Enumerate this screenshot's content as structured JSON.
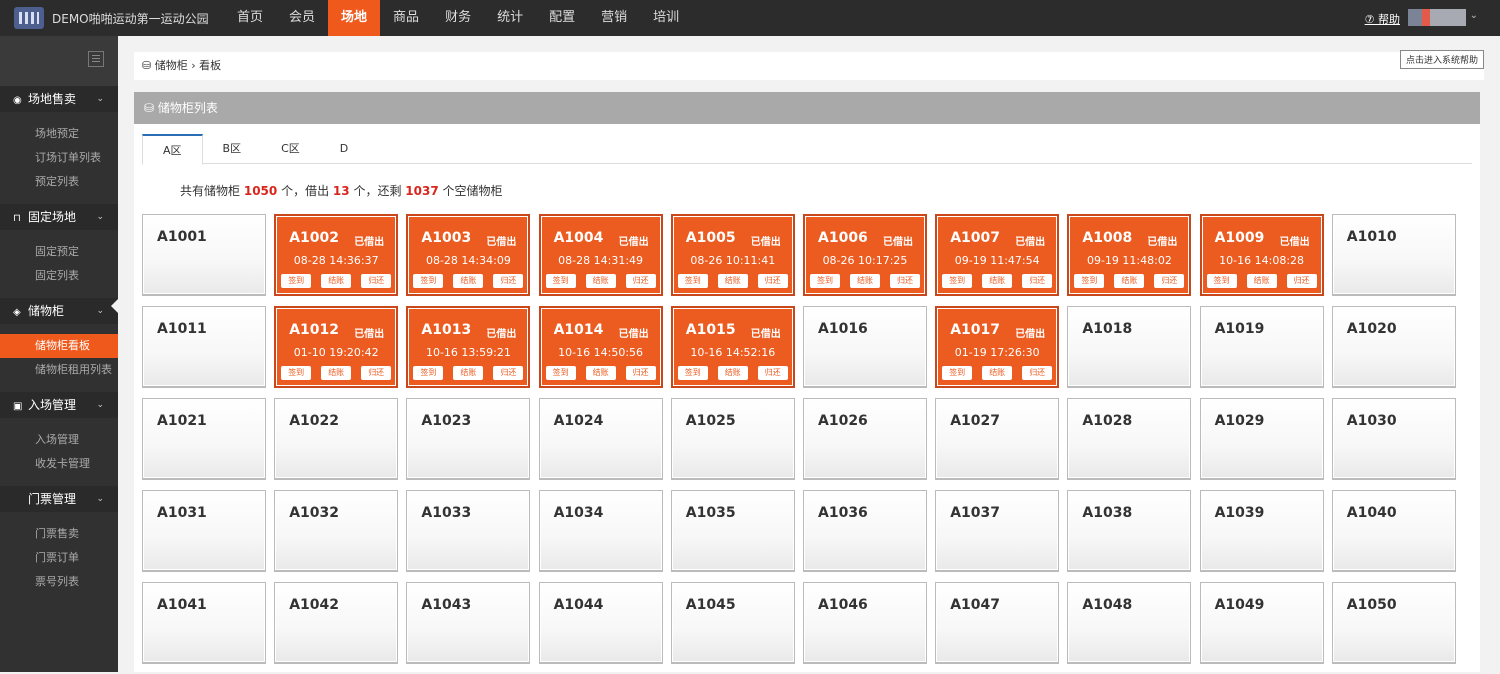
{
  "app": {
    "org_name": "DEMO啪啪运动第一运动公园"
  },
  "topnav": [
    "首页",
    "会员",
    "场地",
    "商品",
    "财务",
    "统计",
    "配置",
    "营销",
    "培训"
  ],
  "topnav_active": 2,
  "help_label": "⑦ 帮助",
  "help_button": "点击进入系统帮助",
  "sidebar": [
    {
      "label": "场地售卖",
      "icon": "globe-icon",
      "items": [
        "场地预定",
        "订场订单列表",
        "预定列表"
      ]
    },
    {
      "label": "固定场地",
      "icon": "bookmark-icon",
      "items": [
        "固定预定",
        "固定列表"
      ]
    },
    {
      "label": "储物柜",
      "icon": "locker-icon",
      "items": [
        "储物柜看板",
        "储物柜租用列表"
      ]
    },
    {
      "label": "入场管理",
      "icon": "id-card-icon",
      "items": [
        "入场管理",
        "收发卡管理"
      ]
    },
    {
      "label": "门票管理",
      "icon": "",
      "items": [
        "门票售卖",
        "门票订单",
        "票号列表"
      ]
    }
  ],
  "sidebar_active_item": "储物柜看板",
  "breadcrumb": {
    "parent": "储物柜",
    "sep": "›",
    "current": "看板"
  },
  "panel_title": "储物柜列表",
  "tabs": [
    "A区",
    "B区",
    "C区",
    "D"
  ],
  "active_tab": 0,
  "summary": {
    "prefix": "共有储物柜",
    "total": "1050",
    "unit1": "个，借出",
    "rented": "13",
    "unit2": "个，还剩",
    "free": "1037",
    "suffix": "个空储物柜"
  },
  "rented_status": "已借出",
  "actions": [
    "签到",
    "结账",
    "归还"
  ],
  "lockers": [
    {
      "name": "A1001"
    },
    {
      "name": "A1002",
      "time": "08-28 14:36:37"
    },
    {
      "name": "A1003",
      "time": "08-28 14:34:09"
    },
    {
      "name": "A1004",
      "time": "08-28 14:31:49"
    },
    {
      "name": "A1005",
      "time": "08-26 10:11:41"
    },
    {
      "name": "A1006",
      "time": "08-26 10:17:25"
    },
    {
      "name": "A1007",
      "time": "09-19 11:47:54"
    },
    {
      "name": "A1008",
      "time": "09-19 11:48:02"
    },
    {
      "name": "A1009",
      "time": "10-16 14:08:28"
    },
    {
      "name": "A1010"
    },
    {
      "name": "A1011"
    },
    {
      "name": "A1012",
      "time": "01-10 19:20:42"
    },
    {
      "name": "A1013",
      "time": "10-16 13:59:21"
    },
    {
      "name": "A1014",
      "time": "10-16 14:50:56"
    },
    {
      "name": "A1015",
      "time": "10-16 14:52:16"
    },
    {
      "name": "A1016"
    },
    {
      "name": "A1017",
      "time": "01-19 17:26:30"
    },
    {
      "name": "A1018"
    },
    {
      "name": "A1019"
    },
    {
      "name": "A1020"
    },
    {
      "name": "A1021"
    },
    {
      "name": "A1022"
    },
    {
      "name": "A1023"
    },
    {
      "name": "A1024"
    },
    {
      "name": "A1025"
    },
    {
      "name": "A1026"
    },
    {
      "name": "A1027"
    },
    {
      "name": "A1028"
    },
    {
      "name": "A1029"
    },
    {
      "name": "A1030"
    },
    {
      "name": "A1031"
    },
    {
      "name": "A1032"
    },
    {
      "name": "A1033"
    },
    {
      "name": "A1034"
    },
    {
      "name": "A1035"
    },
    {
      "name": "A1036"
    },
    {
      "name": "A1037"
    },
    {
      "name": "A1038"
    },
    {
      "name": "A1039"
    },
    {
      "name": "A1040"
    },
    {
      "name": "A1041"
    },
    {
      "name": "A1042"
    },
    {
      "name": "A1043"
    },
    {
      "name": "A1044"
    },
    {
      "name": "A1045"
    },
    {
      "name": "A1046"
    },
    {
      "name": "A1047"
    },
    {
      "name": "A1048"
    },
    {
      "name": "A1049"
    },
    {
      "name": "A1050"
    }
  ],
  "colors": {
    "accent": "#ef5a1c",
    "rented_bg": "#ec5b1f",
    "count_red": "#d9261c",
    "tab_top": "#2a6fb5"
  }
}
